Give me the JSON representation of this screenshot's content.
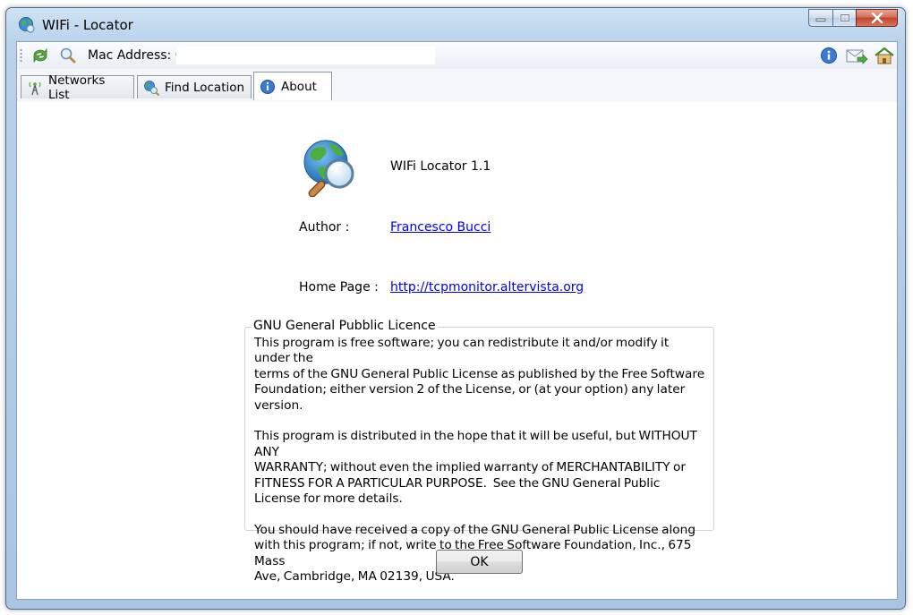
{
  "window": {
    "title": "WIFi - Locator",
    "icons": [
      "globe-icon",
      "minimize-icon",
      "maximize-icon",
      "close-icon"
    ]
  },
  "toolbar": {
    "refresh_icon": "refresh-icon",
    "search_icon": "search-icon",
    "mac_label": "Mac Address: 00-",
    "mac_value": "",
    "right_icons": [
      "info-icon",
      "mail-icon",
      "home-icon"
    ]
  },
  "tabs": [
    {
      "label": "Networks List",
      "icon": "antenna-icon",
      "active": false
    },
    {
      "label": "Find Location",
      "icon": "globe-search-icon",
      "active": false
    },
    {
      "label": "About",
      "icon": "info-icon",
      "active": true
    }
  ],
  "about": {
    "app_name": "WIFi Locator 1.1",
    "author_label": "Author :",
    "author_value": "Francesco Bucci",
    "homepage_label": "Home Page :",
    "homepage_value": "http://tcpmonitor.altervista.org",
    "license_title": "GNU General Pubblic Licence",
    "license_text": "This program is free software; you can redistribute it and/or modify it under the\nterms of the GNU General Public License as published by the Free Software\nFoundation; either version 2 of the License, or (at your option) any later version.\n\nThis program is distributed in the hope that it will be useful, but WITHOUT ANY\nWARRANTY; without even the implied warranty of MERCHANTABILITY or\nFITNESS FOR A PARTICULAR PURPOSE.  See the GNU General Public\nLicense for more details.\n\nYou should have received a copy of the GNU General Public License along\nwith this program; if not, write to the Free Software Foundation, Inc., 675 Mass\nAve, Cambridge, MA 02139, USA.",
    "ok_label": "OK"
  },
  "colors": {
    "frame": "#b9d1ea",
    "close_button": "#c4432c",
    "link": "#0000ee"
  }
}
